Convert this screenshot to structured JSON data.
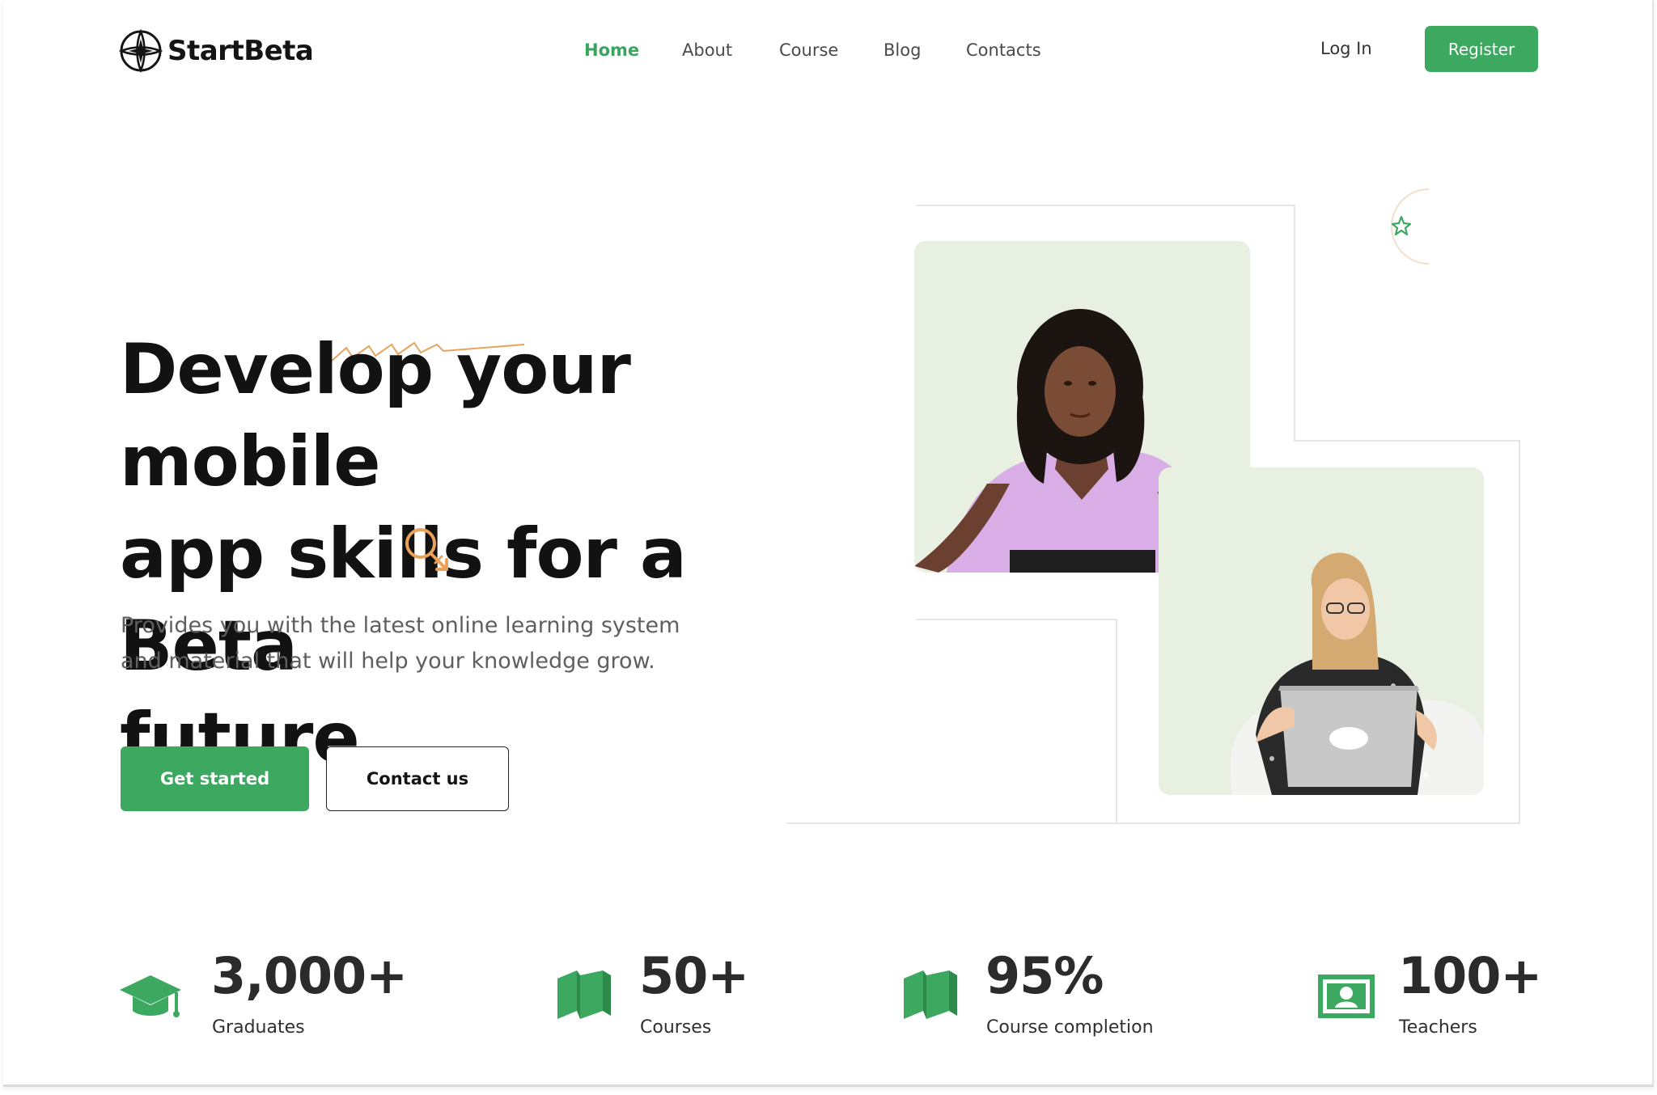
{
  "brand": {
    "name": "StartBeta",
    "accent": "#3da85f",
    "orange": "#e9a25a"
  },
  "nav": {
    "items": [
      {
        "label": "Home",
        "active": true
      },
      {
        "label": "About",
        "active": false
      },
      {
        "label": "Course",
        "active": false
      },
      {
        "label": "Blog",
        "active": false
      },
      {
        "label": "Contacts",
        "active": false
      }
    ]
  },
  "auth": {
    "login_label": "Log In",
    "register_label": "Register"
  },
  "hero": {
    "headline_line1": "Develop your mobile",
    "headline_line2": "app skills for a Beta",
    "headline_line3": "future",
    "subtext_line1": "Provides you with the latest online learning system",
    "subtext_line2": "and material that will help your knowledge grow.",
    "primary_cta": "Get started",
    "secondary_cta": "Contact us",
    "card_bg": "#e8f0e2"
  },
  "stats": [
    {
      "value": "3,000+",
      "label": "Graduates",
      "icon": "graduation-cap-icon"
    },
    {
      "value": "50+",
      "label": "Courses",
      "icon": "books-icon"
    },
    {
      "value": "95%",
      "label": "Course completion",
      "icon": "books-icon"
    },
    {
      "value": "100+",
      "label": "Teachers",
      "icon": "presentation-board-icon"
    }
  ]
}
